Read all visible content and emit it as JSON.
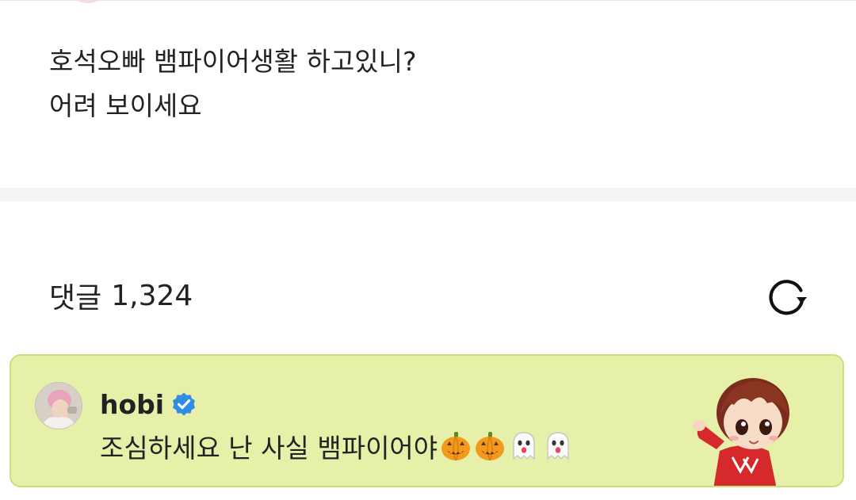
{
  "post": {
    "lines": [
      "호석오빠 뱀파이어생활 하고있니?",
      "어려 보이세요"
    ]
  },
  "comments": {
    "label": "댓글",
    "count": "1,324",
    "refresh_icon": "refresh-icon"
  },
  "pinned_comment": {
    "author": "hobi",
    "verified_icon": "verified-badge-icon",
    "text": "조심하세요 난 사실 뱀파이어야",
    "emojis": [
      "jack-o-lantern",
      "jack-o-lantern",
      "ghost",
      "ghost"
    ],
    "background_color": "#e6f0a8",
    "border_color": "#cbe07a"
  },
  "colors": {
    "verified": "#2f8de4",
    "text": "#222222",
    "divider": "#f4f5f7"
  }
}
